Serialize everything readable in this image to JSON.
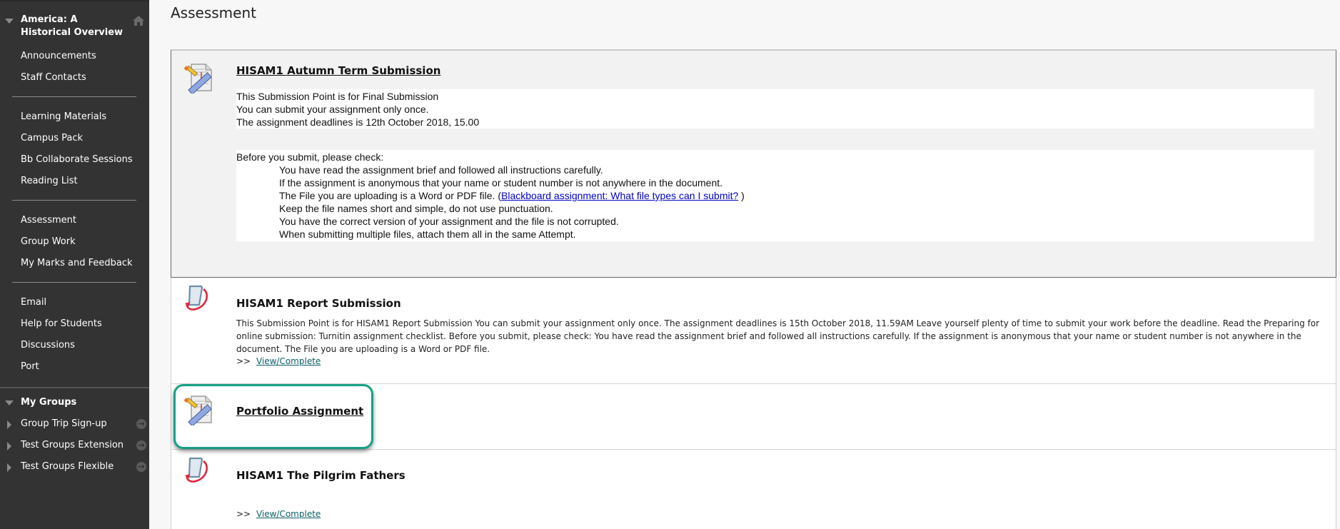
{
  "sidebar": {
    "course_title": "America: A Historical Overview",
    "sections": [
      [
        "Announcements",
        "Staff Contacts"
      ],
      [
        "Learning Materials",
        "Campus Pack",
        "Bb Collaborate Sessions",
        "Reading List"
      ],
      [
        "Assessment",
        "Group Work",
        "My Marks and Feedback"
      ],
      [
        "Email",
        "Help for Students",
        "Discussions",
        "Port"
      ]
    ],
    "my_groups": {
      "label": "My Groups",
      "items": [
        "Group Trip Sign-up",
        "Test Groups Extension",
        "Test Groups Flexible"
      ]
    }
  },
  "main": {
    "page_title": "Assessment",
    "items": [
      {
        "title": "HISAM1 Autumn Term Submission",
        "icon": "assignment-icon",
        "info_lines": [
          "This Submission Point is for Final Submission",
          "You can submit your assignment only once.",
          "The assignment deadlines is 12th October 2018, 15.00"
        ],
        "checklist_heading": "Before you submit, please check:",
        "checklist": [
          "You have read the assignment brief and followed all instructions carefully.",
          "If the assignment is anonymous that your name or student number is not anywhere in the document.",
          "The File you are uploading is a Word or PDF file. (",
          "Keep the file names short and simple, do not use punctuation.",
          "You have the correct version of your assignment and the file is not corrupted.",
          "When submitting multiple files, attach them all in the same Attempt."
        ],
        "checklist_link": "Blackboard assignment: What file types can I submit?",
        "checklist_link_suffix": " )"
      },
      {
        "title": "HISAM1 Report Submission",
        "icon": "turnitin-icon",
        "description": "This Submission Point is for HISAM1 Report Submission You can submit your assignment only once. The assignment deadlines is 15th October 2018, 11.59AM Leave yourself plenty of time to submit your work before the deadline.  Read the Preparing for online submission: Turnitin assignment checklist.  Before you submit, please check: You have read the assignment brief and followed all instructions carefully. If the assignment is anonymous that your name or student number is not anywhere in the document. The File you are uploading is a Word or PDF file.",
        "link_prefix": ">>",
        "link_label": "View/Complete"
      },
      {
        "title": "Portfolio Assignment",
        "icon": "assignment-icon",
        "highlighted": true
      },
      {
        "title": "HISAM1 The Pilgrim Fathers",
        "icon": "turnitin-icon",
        "link_prefix": ">>",
        "link_label": "View/Complete"
      }
    ]
  },
  "colors": {
    "sidebar_bg": "#333333",
    "highlight": "#16a085",
    "link_blue": "#0000cc",
    "link_teal": "#0b5e66"
  }
}
